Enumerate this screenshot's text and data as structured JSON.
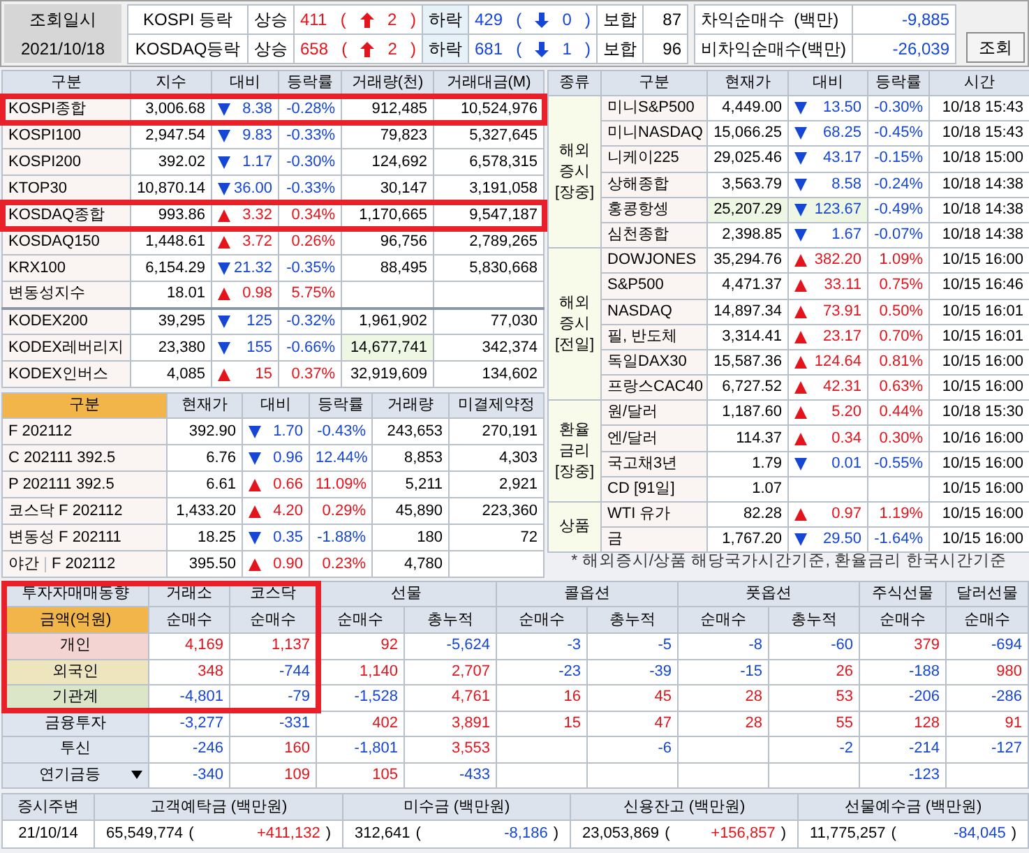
{
  "header": {
    "label": "조회일시",
    "date": "2021/10/18",
    "paren_open": "(",
    "paren_close": ")",
    "breadth": [
      {
        "market": "KOSPI 등락",
        "up_label": "상승",
        "up": "411",
        "up_limit": "2",
        "down_label": "하락",
        "down": "429",
        "down_limit": "0",
        "flat_label": "보합",
        "flat": "87"
      },
      {
        "market": "KOSDAQ등락",
        "up_label": "상승",
        "up": "658",
        "up_limit": "2",
        "down_label": "하락",
        "down": "681",
        "down_limit": "1",
        "flat_label": "보합",
        "flat": "96"
      }
    ],
    "program": [
      {
        "label": "차익순매수  (백만)",
        "value": "-9,885"
      },
      {
        "label": "비차익순매수(백만)",
        "value": "-26,039"
      }
    ],
    "button": "조회"
  },
  "index_table": {
    "columns": [
      "구분",
      "지수",
      "대비",
      "등락률",
      "거래량(천)",
      "거래대금(M)"
    ],
    "groups": [
      [
        {
          "name": "KOSPI종합",
          "value": "3,006.68",
          "up": false,
          "change": "8.38",
          "rate": "-0.28%",
          "volume": "912,485",
          "amount": "10,524,976",
          "highlighted": true,
          "flash": false
        },
        {
          "name": "KOSPI100",
          "value": "2,947.54",
          "up": false,
          "change": "9.83",
          "rate": "-0.33%",
          "volume": "79,823",
          "amount": "5,327,645",
          "highlighted": false,
          "flash": false
        },
        {
          "name": "KOSPI200",
          "value": "392.02",
          "up": false,
          "change": "1.17",
          "rate": "-0.30%",
          "volume": "124,692",
          "amount": "6,578,315",
          "highlighted": false,
          "flash": false
        },
        {
          "name": "KTOP30",
          "value": "10,870.14",
          "up": false,
          "change": "36.00",
          "rate": "-0.33%",
          "volume": "30,147",
          "amount": "3,191,058",
          "highlighted": false,
          "flash": false
        },
        {
          "name": "KOSDAQ종합",
          "value": "993.86",
          "up": true,
          "change": "3.32",
          "rate": "0.34%",
          "volume": "1,170,665",
          "amount": "9,547,187",
          "highlighted": true,
          "flash": false
        },
        {
          "name": "KOSDAQ150",
          "value": "1,448.61",
          "up": true,
          "change": "3.72",
          "rate": "0.26%",
          "volume": "96,756",
          "amount": "2,789,265",
          "highlighted": false,
          "flash": false
        },
        {
          "name": "KRX100",
          "value": "6,154.29",
          "up": false,
          "change": "21.32",
          "rate": "-0.35%",
          "volume": "88,495",
          "amount": "5,830,668",
          "highlighted": false,
          "flash": false
        },
        {
          "name": "변동성지수",
          "value": "18.01",
          "up": true,
          "change": "0.98",
          "rate": "5.75%",
          "highlighted": false,
          "flash": false
        }
      ],
      [
        {
          "name": "KODEX200",
          "value": "39,295",
          "up": false,
          "change": "125",
          "rate": "-0.32%",
          "volume": "1,961,902",
          "amount": "77,030",
          "highlighted": false,
          "flash": false
        },
        {
          "name": "KODEX레버리지",
          "value": "23,380",
          "up": false,
          "change": "155",
          "rate": "-0.66%",
          "volume": "14,677,741",
          "amount": "342,374",
          "highlighted": false,
          "flash": true
        },
        {
          "name": "KODEX인버스",
          "value": "4,085",
          "up": true,
          "change": "15",
          "rate": "0.37%",
          "volume": "32,919,609",
          "amount": "134,602",
          "highlighted": false,
          "flash": false
        }
      ]
    ]
  },
  "futures_table": {
    "columns": [
      "구분",
      "현재가",
      "대비",
      "등락률",
      "거래량",
      "미결제약정"
    ],
    "rows": [
      {
        "name": "F 202112",
        "value": "392.90",
        "up": false,
        "change": "1.70",
        "rate": "-0.43%",
        "volume": "243,653",
        "open_interest": "270,191"
      },
      {
        "name": "C 202111 392.5",
        "value": "6.76",
        "up": false,
        "change": "0.96",
        "rate": "12.44%",
        "volume": "8,853",
        "open_interest": "4,303"
      },
      {
        "name": "P 202111 392.5",
        "value": "6.61",
        "up": true,
        "change": "0.66",
        "rate": "11.09%",
        "volume": "5,211",
        "open_interest": "2,921"
      },
      {
        "name": "코스닥 F 202112",
        "value": "1,433.20",
        "up": true,
        "change": "4.20",
        "rate": "0.29%",
        "volume": "45,890",
        "open_interest": "223,360"
      },
      {
        "name": "변동성 F 202111",
        "value": "18.25",
        "up": false,
        "change": "0.35",
        "rate": "-1.88%",
        "volume": "180",
        "open_interest": "72"
      },
      {
        "tag": "야간",
        "name": "F 202112",
        "value": "395.50",
        "up": true,
        "change": "0.90",
        "rate": "0.23%",
        "volume": "4,780"
      }
    ]
  },
  "world_table": {
    "columns": [
      "종류",
      "구분",
      "현재가",
      "대비",
      "등락률",
      "시간"
    ],
    "groups": [
      {
        "label": "해외\n증시\n[장중]",
        "rows": [
          {
            "name": "미니S&P500",
            "value": "4,449.00",
            "up": false,
            "change": "13.50",
            "rate": "-0.30%",
            "time": "10/18 15:43",
            "flash": false
          },
          {
            "name": "미니NASDAQ",
            "value": "15,066.25",
            "up": false,
            "change": "68.25",
            "rate": "-0.45%",
            "time": "10/18 15:43",
            "flash": false
          },
          {
            "name": "니케이225",
            "value": "29,025.46",
            "up": false,
            "change": "43.17",
            "rate": "-0.15%",
            "time": "10/18 15:00",
            "flash": false
          },
          {
            "name": "상해종합",
            "value": "3,563.79",
            "up": false,
            "change": "8.58",
            "rate": "-0.24%",
            "time": "10/18 14:38",
            "flash": false
          },
          {
            "name": "홍콩항셍",
            "value": "25,207.29",
            "up": false,
            "change": "123.67",
            "rate": "-0.49%",
            "time": "10/18 14:38",
            "flash": true
          },
          {
            "name": "심천종합",
            "value": "2,398.85",
            "up": false,
            "change": "1.67",
            "rate": "-0.07%",
            "time": "10/18 14:38",
            "flash": false
          }
        ]
      },
      {
        "label": "해외\n증시\n[전일]",
        "rows": [
          {
            "name": "DOWJONES",
            "value": "35,294.76",
            "up": true,
            "change": "382.20",
            "rate": "1.09%",
            "time": "10/15 16:00",
            "flash": false
          },
          {
            "name": "S&P500",
            "value": "4,471.37",
            "up": true,
            "change": "33.11",
            "rate": "0.75%",
            "time": "10/15 16:46",
            "flash": false
          },
          {
            "name": "NASDAQ",
            "value": "14,897.34",
            "up": true,
            "change": "73.91",
            "rate": "0.50%",
            "time": "10/15 16:01",
            "flash": false
          },
          {
            "name": "필, 반도체",
            "value": "3,314.41",
            "up": true,
            "change": "23.17",
            "rate": "0.70%",
            "time": "10/15 16:01",
            "flash": false
          },
          {
            "name": "독일DAX30",
            "value": "15,587.36",
            "up": true,
            "change": "124.64",
            "rate": "0.81%",
            "time": "10/15 16:00",
            "flash": false
          },
          {
            "name": "프랑스CAC40",
            "value": "6,727.52",
            "up": true,
            "change": "42.31",
            "rate": "0.63%",
            "time": "10/15 16:00",
            "flash": false
          }
        ]
      },
      {
        "label": "환율\n금리\n[장중]",
        "rows": [
          {
            "name": "원/달러",
            "value": "1,187.60",
            "up": true,
            "change": "5.20",
            "rate": "0.44%",
            "time": "10/18 15:30",
            "flash": false
          },
          {
            "name": "엔/달러",
            "value": "114.37",
            "up": true,
            "change": "0.34",
            "rate": "0.30%",
            "time": "10/16 16:00",
            "flash": false
          },
          {
            "name": "국고채3년",
            "value": "1.79",
            "up": false,
            "change": "0.01",
            "rate": "-0.55%",
            "time": "10/15 16:00",
            "flash": false
          },
          {
            "name": "CD [91일]",
            "value": "1.07",
            "time": "10/15 16:00",
            "flash": false
          }
        ]
      },
      {
        "label": "상품",
        "rows": [
          {
            "name": "WTI 유가",
            "value": "82.28",
            "up": true,
            "change": "0.97",
            "rate": "1.19%",
            "time": "10/15 16:00",
            "flash": false
          },
          {
            "name": "금",
            "value": "1,767.20",
            "up": false,
            "change": "29.50",
            "rate": "-1.64%",
            "time": "10/15 16:00",
            "flash": false
          }
        ]
      }
    ],
    "note": "* 해외증시/상품 해당국가시간기준, 환율금리 한국시간기준"
  },
  "investor_table": {
    "title": "투자자매매동향",
    "unit": "금액(억원)",
    "highlighted": true,
    "groups": [
      {
        "label": "거래소",
        "subs": [
          "순매수"
        ]
      },
      {
        "label": "코스닥",
        "subs": [
          "순매수"
        ]
      },
      {
        "label": "선물",
        "subs": [
          "순매수",
          "총누적"
        ]
      },
      {
        "label": "콜옵션",
        "subs": [
          "순매수",
          "총누적"
        ]
      },
      {
        "label": "풋옵션",
        "subs": [
          "순매수",
          "총누적"
        ]
      },
      {
        "label": "주식선물",
        "subs": [
          "순매수"
        ]
      },
      {
        "label": "달러선물",
        "subs": [
          "순매수"
        ]
      }
    ],
    "rows": [
      {
        "name": "개인",
        "color": "#f4d4d2",
        "dropdown": false,
        "values": {
          "exchange": "4,169",
          "kosdaq": "1,137",
          "futures_net": "92",
          "futures_total": "-5,624",
          "call_net": "-3",
          "call_total": "-5",
          "put_net": "-8",
          "put_total": "-60",
          "stock_futures": "379",
          "dollar_futures": "-694"
        }
      },
      {
        "name": "외국인",
        "color": "#ede5bd",
        "dropdown": false,
        "values": {
          "exchange": "348",
          "kosdaq": "-744",
          "futures_net": "1,140",
          "futures_total": "2,707",
          "call_net": "-23",
          "call_total": "-39",
          "put_net": "-15",
          "put_total": "26",
          "stock_futures": "-188",
          "dollar_futures": "980"
        }
      },
      {
        "name": "기관계",
        "color": "#dbe5c8",
        "dropdown": false,
        "values": {
          "exchange": "-4,801",
          "kosdaq": "-79",
          "futures_net": "-1,528",
          "futures_total": "4,761",
          "call_net": "16",
          "call_total": "45",
          "put_net": "28",
          "put_total": "53",
          "stock_futures": "-206",
          "dollar_futures": "-286"
        }
      },
      {
        "name": "금융투자",
        "color": "#dfe5ee",
        "dropdown": false,
        "values": {
          "exchange": "-3,277",
          "kosdaq": "-331",
          "futures_net": "402",
          "futures_total": "3,891",
          "call_net": "15",
          "call_total": "47",
          "put_net": "28",
          "put_total": "55",
          "stock_futures": "128",
          "dollar_futures": "91"
        }
      },
      {
        "name": "투신",
        "color": "#dfe5ee",
        "dropdown": false,
        "values": {
          "exchange": "-246",
          "kosdaq": "160",
          "futures_net": "-1,801",
          "futures_total": "3,553",
          "call_total": "-6",
          "put_total": "-2",
          "stock_futures": "-214",
          "dollar_futures": "-127"
        }
      },
      {
        "name": "연기금등",
        "color": "#dfe5ee",
        "dropdown": true,
        "values": {
          "exchange": "-340",
          "kosdaq": "109",
          "futures_net": "105",
          "futures_total": "-433",
          "stock_futures": "-123"
        }
      }
    ]
  },
  "footer": {
    "columns": [
      "증시주변",
      "고객예탁금 (백만원)",
      "미수금 (백만원)",
      "신용잔고 (백만원)",
      "선물예수금 (백만원)"
    ],
    "date": "21/10/14",
    "paren_open": "(",
    "paren_close": ")",
    "items": [
      {
        "value": "65,549,774",
        "change": "+411,132"
      },
      {
        "value": "312,641",
        "change": "-8,186"
      },
      {
        "value": "23,053,869",
        "change": "+156,857"
      },
      {
        "value": "11,775,257",
        "change": "-84,045"
      }
    ]
  }
}
